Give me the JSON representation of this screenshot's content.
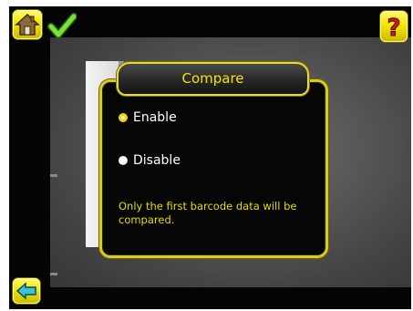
{
  "toolbar": {
    "home_icon": "home-icon",
    "status_icon": "checkmark-icon",
    "help_icon": "help-question-icon",
    "back_icon": "back-arrow-icon"
  },
  "dialog": {
    "title": "Compare",
    "options": [
      {
        "label": "Enable",
        "selected": true
      },
      {
        "label": "Disable",
        "selected": false
      }
    ],
    "note": "Only the first barcode data will be compared."
  },
  "colors": {
    "accent": "#f5e600",
    "dialog_border": "#d8ca2a",
    "text_highlight": "#e8dc00",
    "background": "#050505"
  }
}
